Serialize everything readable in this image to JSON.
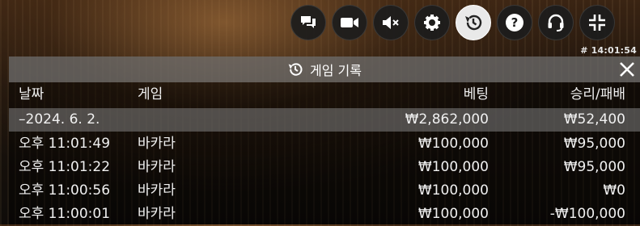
{
  "toolbar": {
    "buttons": [
      {
        "icon": "chat-icon",
        "active": false
      },
      {
        "icon": "video-camera-icon",
        "active": false
      },
      {
        "icon": "sound-muted-icon",
        "active": false
      },
      {
        "icon": "settings-gear-icon",
        "active": false
      },
      {
        "icon": "history-icon",
        "active": true
      },
      {
        "icon": "help-icon",
        "active": false
      },
      {
        "icon": "headset-icon",
        "active": false
      },
      {
        "icon": "minimize-icon",
        "active": false
      }
    ],
    "clock": "# 14:01:54"
  },
  "panel": {
    "title": "게임 기록",
    "columns": {
      "date": "날짜",
      "game": "게임",
      "bet": "베팅",
      "win": "승리/패배"
    },
    "summary": {
      "date": "–2024. 6. 2.",
      "bet": "₩2,862,000",
      "win": "₩52,400"
    },
    "rows": [
      {
        "time": "오후 11:01:49",
        "game": "바카라",
        "bet": "₩100,000",
        "win": "₩95,000"
      },
      {
        "time": "오후 11:01:22",
        "game": "바카라",
        "bet": "₩100,000",
        "win": "₩95,000"
      },
      {
        "time": "오후 11:00:56",
        "game": "바카라",
        "bet": "₩100,000",
        "win": "₩0"
      },
      {
        "time": "오후 11:00:01",
        "game": "바카라",
        "bet": "₩100,000",
        "win": "-₩100,000"
      }
    ]
  },
  "colors": {
    "header_bg": "#8f8f8f",
    "summary_bg": "#7f7f7f",
    "active_button": "#e9e9e9",
    "button_bg": "#1c1c1c"
  }
}
